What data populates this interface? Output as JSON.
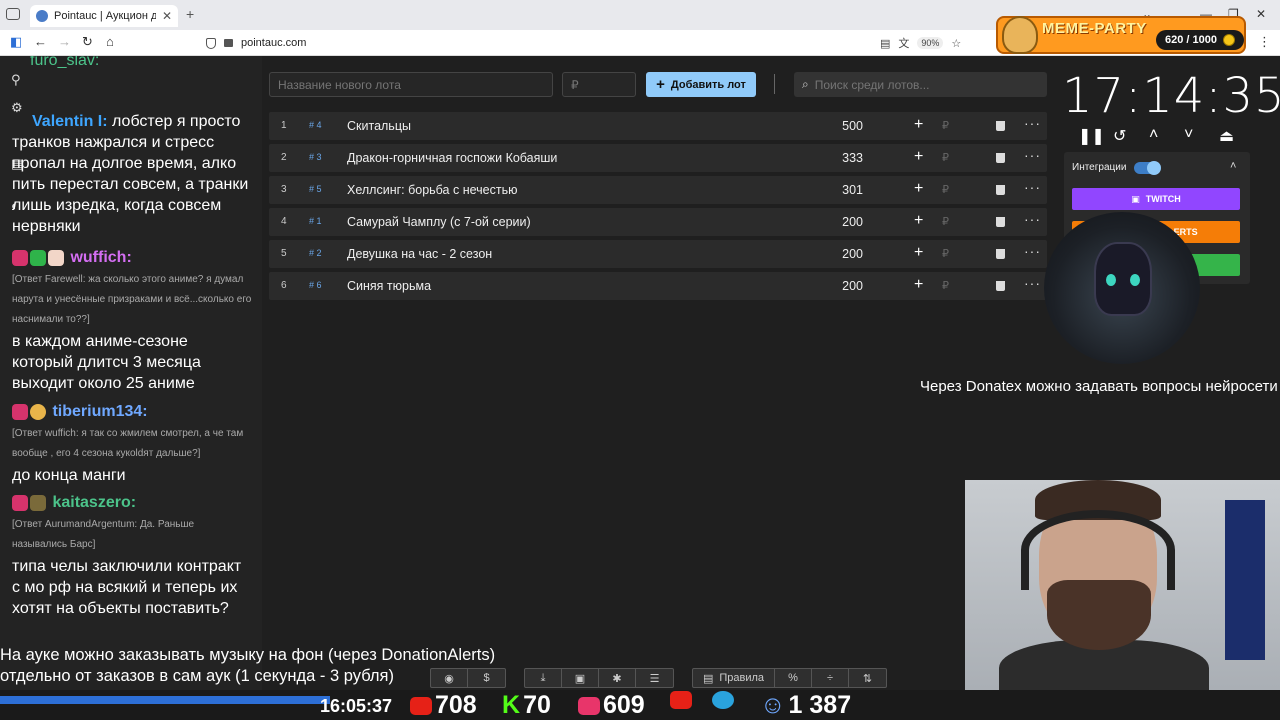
{
  "browser": {
    "tab_title": "Pointauc | Аукцион для стрима",
    "url": "pointauc.com",
    "zoom": "90%"
  },
  "meme_party": {
    "title": "MEME-PARTY",
    "count": "620 / 1000"
  },
  "chat": {
    "top_nick": "furo_slav:",
    "messages": [
      {
        "nick": "Valentin I:",
        "nick_color": "#3ea6ff",
        "text": "лобстер я просто транков нажрался и стресс пропал на долгое время, алко пить перестал совсем, а транки лишь изредка, когда совсем нервняки"
      },
      {
        "nick": "wuffich:",
        "nick_color": "#d46ef2",
        "reply": "[Ответ Farewell: жа сколько этого аниме? я думал нарута и унесённые призраками и всё...сколько его наснимали то??]",
        "text": "в каждом аниме-сезоне который длитсч 3 месяца выходит около 25 аниме"
      },
      {
        "nick": "tiberium134:",
        "nick_color": "#6fa8ff",
        "reply": "[Ответ wuffich: я так со жмилем смотрел, а че там вообще , его 4 сезона кукоldят дальше?]",
        "text": "до конца манги"
      },
      {
        "nick": "kaitaszero:",
        "nick_color": "#4cc38a",
        "reply": "[Ответ AurumandArgentum: Да. Раньше назывались Барс]",
        "text": "типа челы заключили контракт с мо рф на всякий и теперь их хотят на объекты поставить?"
      }
    ]
  },
  "app": {
    "lot_name_placeholder": "Название нового лота",
    "price_placeholder": "₽",
    "add_button": "Добавить лот",
    "search_placeholder": "Поиск среди лотов...",
    "lots": [
      {
        "num": "1",
        "id": "# 4",
        "name": "Скитальцы",
        "amount": "500"
      },
      {
        "num": "2",
        "id": "# 3",
        "name": "Дракон-горничная госпожи Кобаяши",
        "amount": "333"
      },
      {
        "num": "3",
        "id": "# 5",
        "name": "Хеллсинг: борьба с нечестью",
        "amount": "301"
      },
      {
        "num": "4",
        "id": "# 1",
        "name": "Самурай Чамплу (с 7-ой серии)",
        "amount": "200"
      },
      {
        "num": "5",
        "id": "# 2",
        "name": "Девушка на час - 2 сезон",
        "amount": "200"
      },
      {
        "num": "6",
        "id": "# 6",
        "name": "Синяя тюрьма",
        "amount": "200"
      }
    ],
    "ruble": "₽"
  },
  "timer": {
    "time": "17:14:35"
  },
  "integrations": {
    "label": "Интеграции",
    "twitch": "TWITCH",
    "donationalerts": "DONATIONALERTS",
    "colors": {
      "twitch": "#9146ff",
      "donationalerts": "#f57d07",
      "third": "#35b44a"
    }
  },
  "overlay": {
    "banner": "Через Donatex можно задавать вопросы нейросети",
    "caption_line1": "На ауке можно заказывать музыку на фон (через DonationAlerts)",
    "caption_line2": "отдельно от заказов в сам аук (1 секунда - 3 рубля)"
  },
  "toolbar": {
    "rules": "Правила"
  },
  "status": {
    "time": "16:05:37",
    "youtube": "708",
    "kick": "70",
    "vk": "609",
    "viewers": "1 387"
  }
}
